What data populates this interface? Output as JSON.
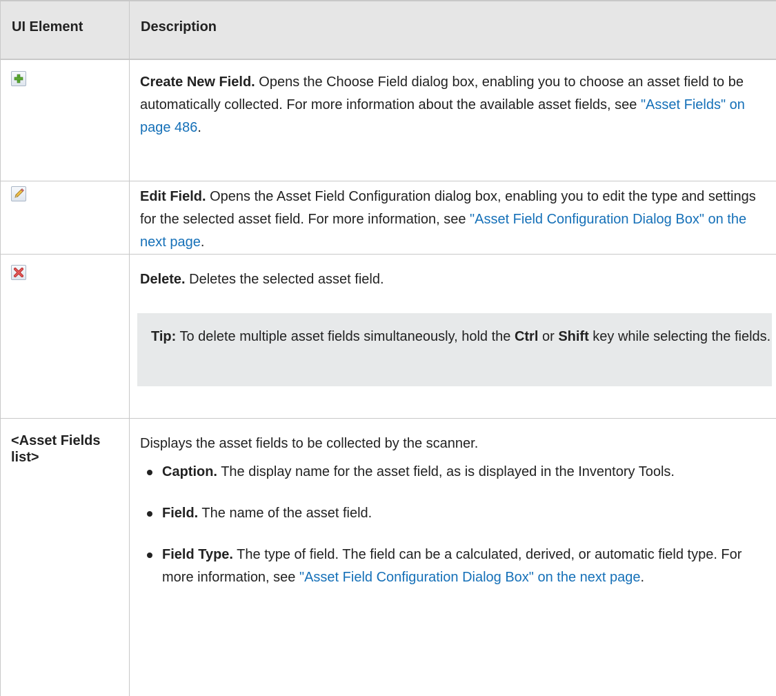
{
  "header": {
    "col1": "UI Element",
    "col2": "Description"
  },
  "rows": {
    "create": {
      "icon": "plus-icon",
      "title": "Create New Field.",
      "text": " Opens the Choose Field dialog box, enabling you to choose an asset field to be automatically collected. For more information about the available asset fields, see ",
      "link": "\"Asset Fields\" on page 486",
      "after": "."
    },
    "edit": {
      "icon": "pencil-icon",
      "title": "Edit Field.",
      "text": " Opens the Asset Field Configuration dialog box, enabling you to edit the type and settings for the selected asset field. For more information, see ",
      "link": "\"Asset Field Configuration Dialog Box\" on the next page",
      "after": "."
    },
    "delete": {
      "icon": "delete-x-icon",
      "title": "Delete.",
      "text": " Deletes the selected asset field.",
      "tip_label": "Tip:",
      "tip_text_1": " To delete multiple asset fields simultaneously, hold the ",
      "tip_key_1": "Ctrl",
      "tip_text_2": " or ",
      "tip_key_2": "Shift",
      "tip_text_3": " key while selecting the fields."
    },
    "list": {
      "label": "<Asset Fields list>",
      "intro": "Displays the asset fields to be collected by the scanner.",
      "items": [
        {
          "title": "Caption.",
          "text": " The display name for the asset field, as is displayed in the Inventory Tools."
        },
        {
          "title": "Field.",
          "text": " The name of the asset field."
        },
        {
          "title": "Field Type.",
          "text": " The type of field. The field can be a calculated, derived, or automatic field type. For more information, see ",
          "link": "\"Asset Field Configuration Dialog Box\" on the next page",
          "after": "."
        }
      ]
    }
  },
  "colors": {
    "link": "#1570b8",
    "header_bg": "#e6e6e6",
    "tip_bg": "#e7e9ea"
  }
}
